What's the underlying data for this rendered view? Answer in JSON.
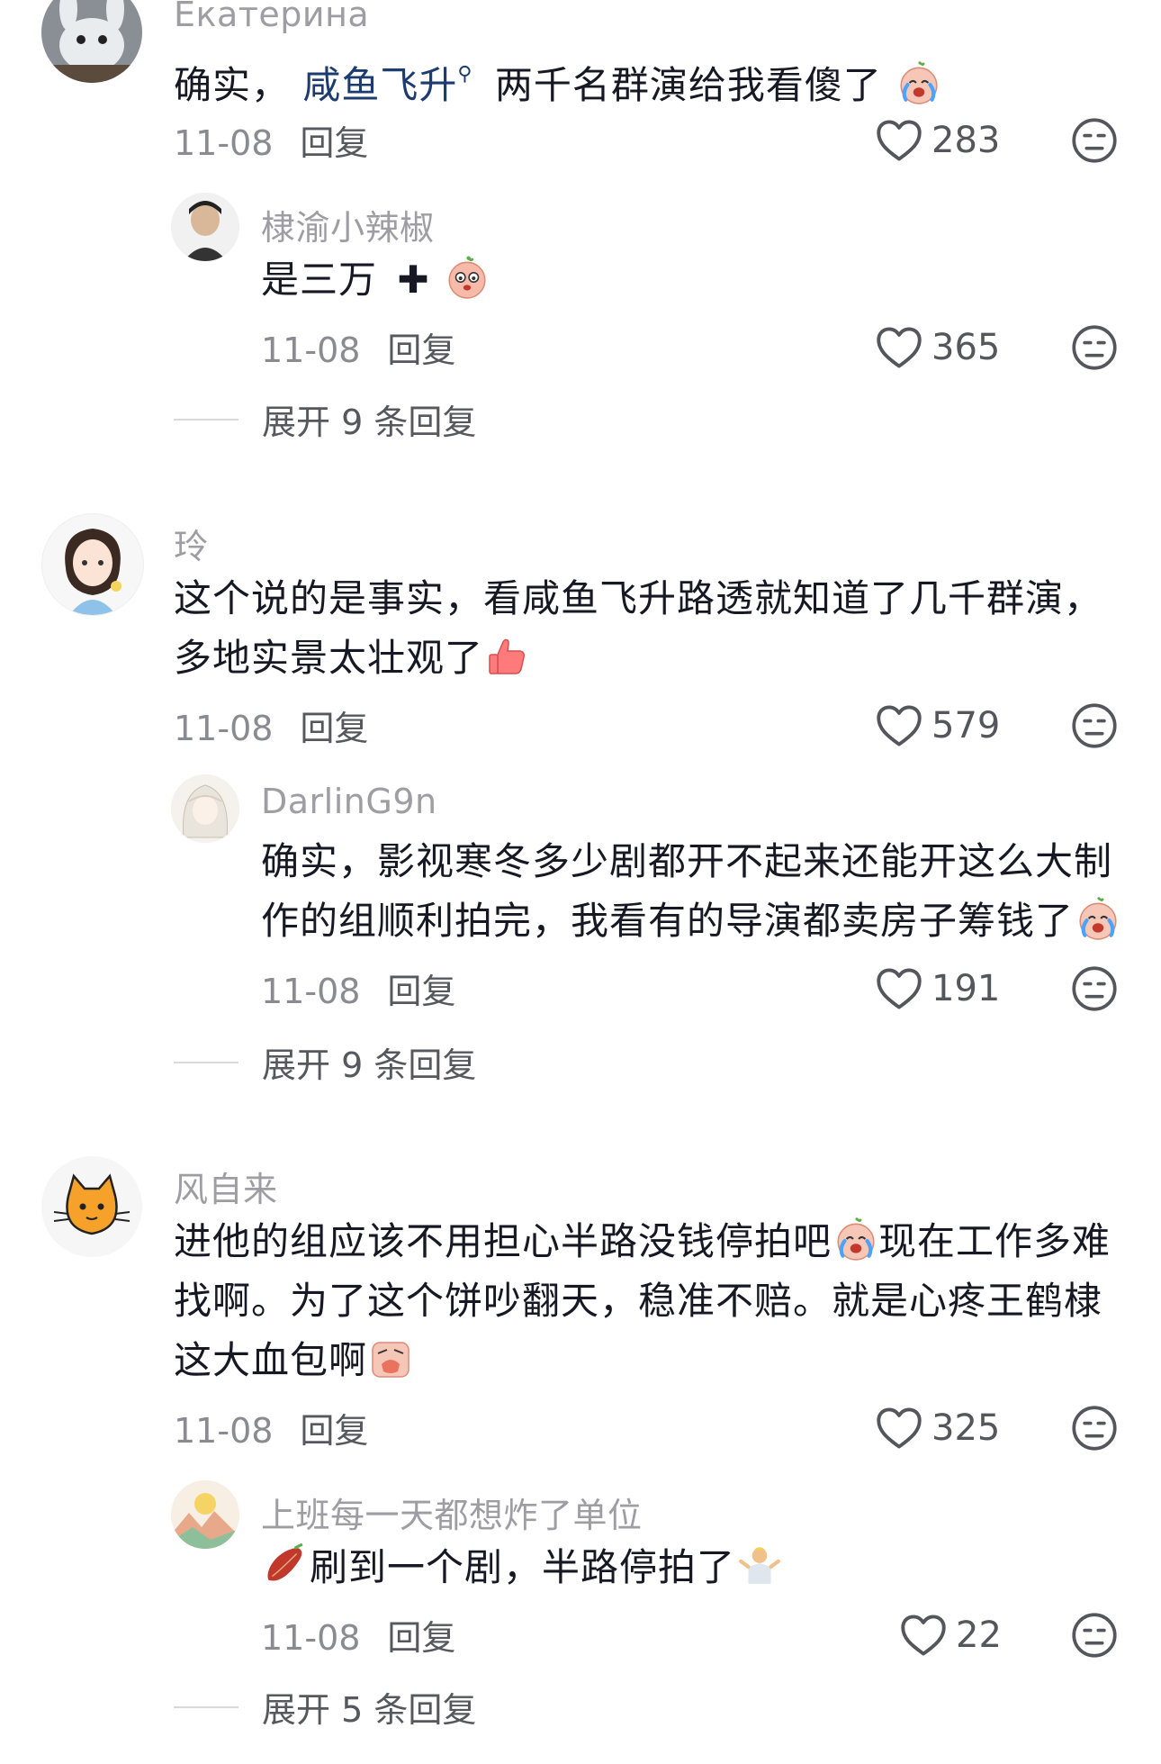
{
  "comments": [
    {
      "user": "Екатерина",
      "text_before": "确实，",
      "link": "咸鱼飞升",
      "text_after": "两千名群演给我看傻了",
      "date": "11-08",
      "reply_label": "回复",
      "likes": "283",
      "replies": [
        {
          "user": "棣渝小辣椒",
          "text": "是三万",
          "date": "11-08",
          "reply_label": "回复",
          "likes": "365"
        }
      ],
      "expand_label": "展开 9 条回复"
    },
    {
      "user": "玲",
      "line1": "这个说的是事实，看咸鱼飞升路透就知道了几千群演，",
      "line2": "多地实景太壮观了",
      "date": "11-08",
      "reply_label": "回复",
      "likes": "579",
      "replies": [
        {
          "user": "DarlinG9n",
          "line1": "确实，影视寒冬多少剧都开不起来还能开这么大制",
          "line2": "作的组顺利拍完，我看有的导演都卖房子筹钱了",
          "date": "11-08",
          "reply_label": "回复",
          "likes": "191"
        }
      ],
      "expand_label": "展开 9 条回复"
    },
    {
      "user": "风自来",
      "line1": "进他的组应该不用担心半路没钱停拍吧",
      "line1b": "现在工作多难",
      "line2": "找啊。为了这个饼吵翻天，稳准不赔。就是心疼王鹤棣",
      "line3": "这大血包啊",
      "date": "11-08",
      "reply_label": "回复",
      "likes": "325",
      "replies": [
        {
          "user": "上班每一天都想炸了单位",
          "text": "刷到一个剧，半路停拍了",
          "date": "11-08",
          "reply_label": "回复",
          "likes": "22"
        }
      ],
      "expand_label": "展开 5 条回复"
    }
  ],
  "icons": {
    "like": "heart-outline-icon",
    "dislike": "meh-face-icon",
    "search_hint": "search-icon"
  },
  "colors": {
    "link": "#1c3b6f",
    "muted": "#9d9da3",
    "text": "#161823"
  }
}
